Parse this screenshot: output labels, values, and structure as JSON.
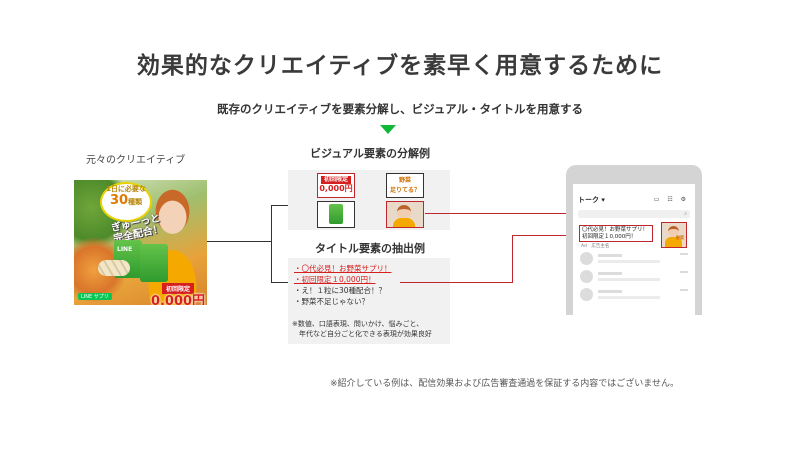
{
  "heading": {
    "title": "効果的なクリエイティブを素早く用意するために",
    "subtitle": "既存のクリエイティブを要素分解し、ビジュアル・タイトルを用意する"
  },
  "original": {
    "label": "元々のクリエイティブ",
    "badge_top": "1日に必要な",
    "badge_num": "30",
    "badge_unit": "種類",
    "badge_line2": "ぎゅーっと",
    "badge_line3": "完全配合！",
    "price_label": "初回限定",
    "price": "0,000円",
    "logo_text": "LINE サプリ",
    "pack_text": "LINE"
  },
  "visual": {
    "heading": "ビジュアル要素の分解例",
    "tile_price_label": "初回限定",
    "tile_price": "0,000円",
    "tile_veg_line1": "野菜",
    "tile_veg_line2": "足りてる？"
  },
  "titles": {
    "heading": "タイトル要素の抽出例",
    "items": [
      "・〇代必見！お野菜サプリ！",
      "・初回限定１0,000円！",
      "・え！１粒に30種配合！？",
      "・野菜不足じゃない？"
    ],
    "note_line1": "※数値、口語表現、問いかけ、悩みごと、",
    "note_line2": "　年代など自分ごと化できる表現が効果良好"
  },
  "phone": {
    "header": "トーク ▾",
    "header_icons": "▭ ☷ ⚙",
    "ad_line1": "〇代必見！お野菜サプリ！",
    "ad_line2": "初回限定１0,000円！",
    "ad_label": "Ad　広告主名",
    "thumb_text": "野菜"
  },
  "disclaimer": "※紹介している例は、配信効果および広告審査通過を保証する内容ではございません。",
  "colors": {
    "arrow_green": "#10b838",
    "highlight_red": "#c0272d",
    "price_red": "#d62020",
    "panel_gray": "#f1f1f1"
  }
}
